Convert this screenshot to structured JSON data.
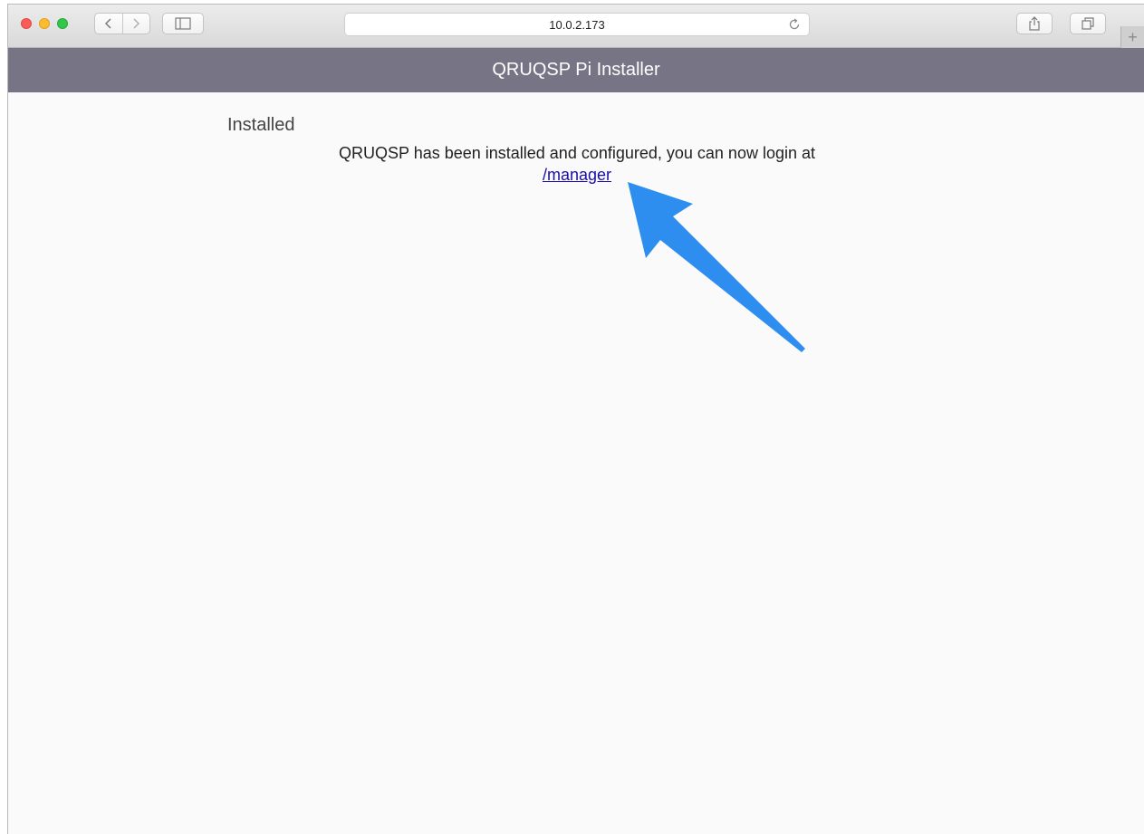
{
  "browser": {
    "url": "10.0.2.173",
    "new_tab_glyph": "+"
  },
  "page": {
    "header_title": "QRUQSP Pi Installer",
    "section_title": "Installed",
    "message_text": "QRUQSP has been installed and configured, you can now login at",
    "link_text": "/manager"
  },
  "annotation": {
    "arrow_color": "#2e8ef0"
  },
  "colors": {
    "header_bg": "#777585",
    "link": "#1a0dab"
  }
}
